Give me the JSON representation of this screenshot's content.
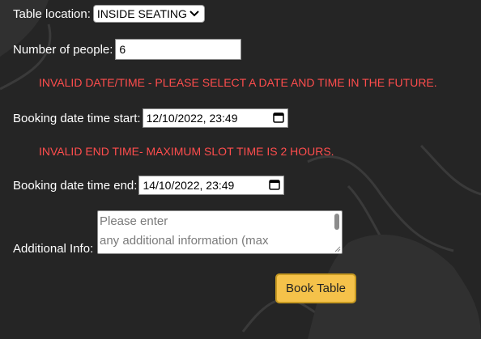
{
  "form": {
    "table_location": {
      "label": "Table location:",
      "value": "INSIDE SEATING"
    },
    "num_people": {
      "label": "Number of people:",
      "value": "6"
    },
    "error_datetime": "INVALID DATE/TIME - PLEASE SELECT A DATE AND TIME IN THE FUTURE.",
    "start": {
      "label": "Booking date time start:",
      "value": "12/10/2022, 23:49"
    },
    "error_endtime": "INVALID END TIME- MAXIMUM SLOT TIME IS 2 HOURS.",
    "end": {
      "label": "Booking date time end:",
      "value": "14/10/2022, 23:49"
    },
    "additional": {
      "label": "Additional Info:",
      "placeholder_line1": "Please enter",
      "placeholder_line2": "any additional information (max"
    },
    "submit_label": "Book Table"
  },
  "colors": {
    "background": "#252525",
    "error": "#ff4d4d",
    "button": "#f5c24a"
  },
  "icons": [
    "chevron-down-icon",
    "calendar-icon",
    "resize-handle-icon"
  ]
}
